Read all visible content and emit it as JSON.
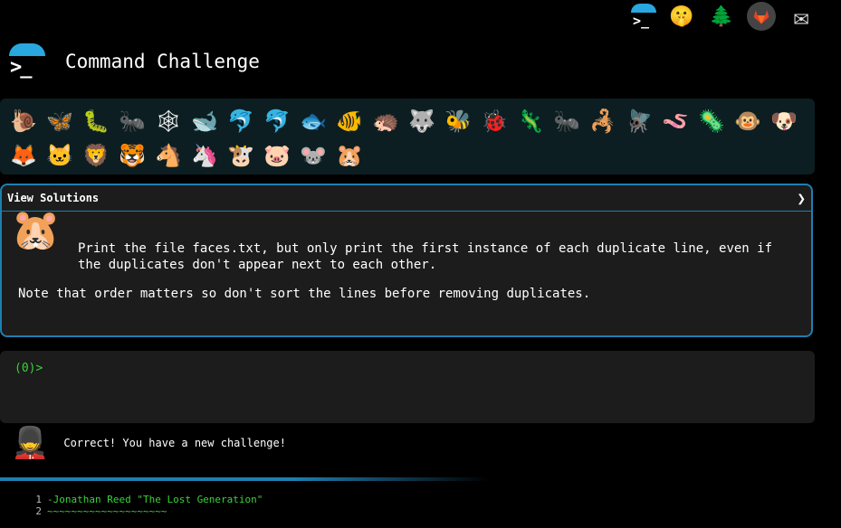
{
  "top_icons": [
    {
      "name": "terminal-icon"
    },
    {
      "name": "shush-face-icon",
      "glyph": "🤫"
    },
    {
      "name": "tree-icon",
      "glyph": "🌲"
    },
    {
      "name": "gitlab-icon"
    },
    {
      "name": "mail-icon",
      "glyph": "✉"
    }
  ],
  "header": {
    "title": "Command Challenge"
  },
  "levels": [
    "🐌",
    "🦋",
    "🐛",
    "🐜",
    "🕸",
    "🐋",
    "🐬",
    "🐬",
    "🐟",
    "🐠",
    "🦔",
    "🐺",
    "🐝",
    "🐞",
    "🦎",
    "🐜",
    "🦂",
    "🪰",
    "🪱",
    "🦠",
    "🐵",
    "🐶",
    "🦊",
    "🐱",
    "🦁",
    "🐯",
    "🐴",
    "🦄",
    "🐮",
    "🐷",
    "🐭",
    "🐹"
  ],
  "panel": {
    "header": "View Solutions",
    "chevron": "❯",
    "avatar": "🐹",
    "description_1": "Print the file faces.txt, but only print the first instance of each duplicate line, even if the duplicates don't appear next to each other.",
    "description_2": "Note that order matters so don't sort the lines before removing duplicates."
  },
  "terminal": {
    "prompt": "(0)>"
  },
  "status": {
    "avatar": "💂",
    "text": "Correct! You have a new challenge!"
  },
  "output": {
    "line_numbers": [
      "1",
      "2"
    ],
    "line1": "-Jonathan Reed \"The Lost Generation\"",
    "line2": "~~~~~~~~~~~~~~~~~~~~"
  },
  "colors": {
    "accent": "#29a8e0",
    "prompt_green": "#3ad23a",
    "panel_bg": "#1c1c1c",
    "levels_bg": "#0c1e22"
  }
}
